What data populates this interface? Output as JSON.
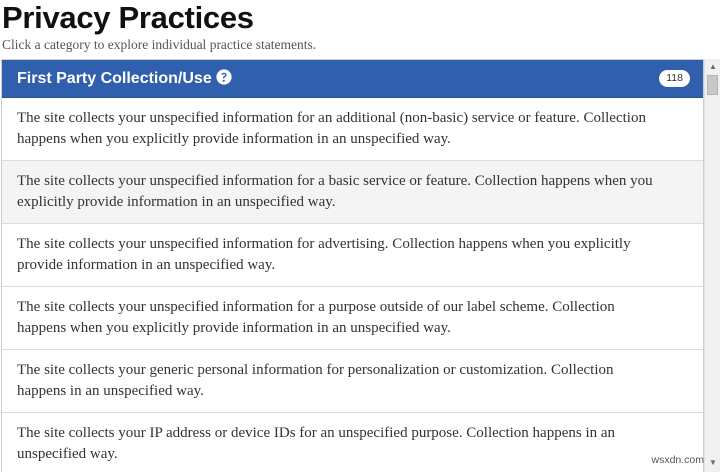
{
  "page": {
    "title": "Privacy Practices",
    "subtitle": "Click a category to explore individual practice statements."
  },
  "category": {
    "title": "First Party Collection/Use",
    "count": "118",
    "help_icon": "question-circle-icon",
    "header_color": "#3060ad"
  },
  "practices": [
    "The site collects your unspecified information for an additional (non-basic) service or feature. Collection happens when you explicitly provide information in an unspecified way.",
    "The site collects your unspecified information for a basic service or feature. Collection happens when you explicitly provide information in an unspecified way.",
    "The site collects your unspecified information for advertising. Collection happens when you explicitly provide information in an unspecified way.",
    "The site collects your unspecified information for a purpose outside of our label scheme. Collection happens when you explicitly provide information in an unspecified way.",
    "The site collects your generic personal information for personalization or customization. Collection happens in an unspecified way.",
    "The site collects your IP address or device IDs for an unspecified purpose. Collection happens in an unspecified way."
  ],
  "scrollbar": {
    "up_icon": "triangle-up-icon",
    "down_icon": "triangle-down-icon"
  },
  "watermark": "wsxdn.com"
}
